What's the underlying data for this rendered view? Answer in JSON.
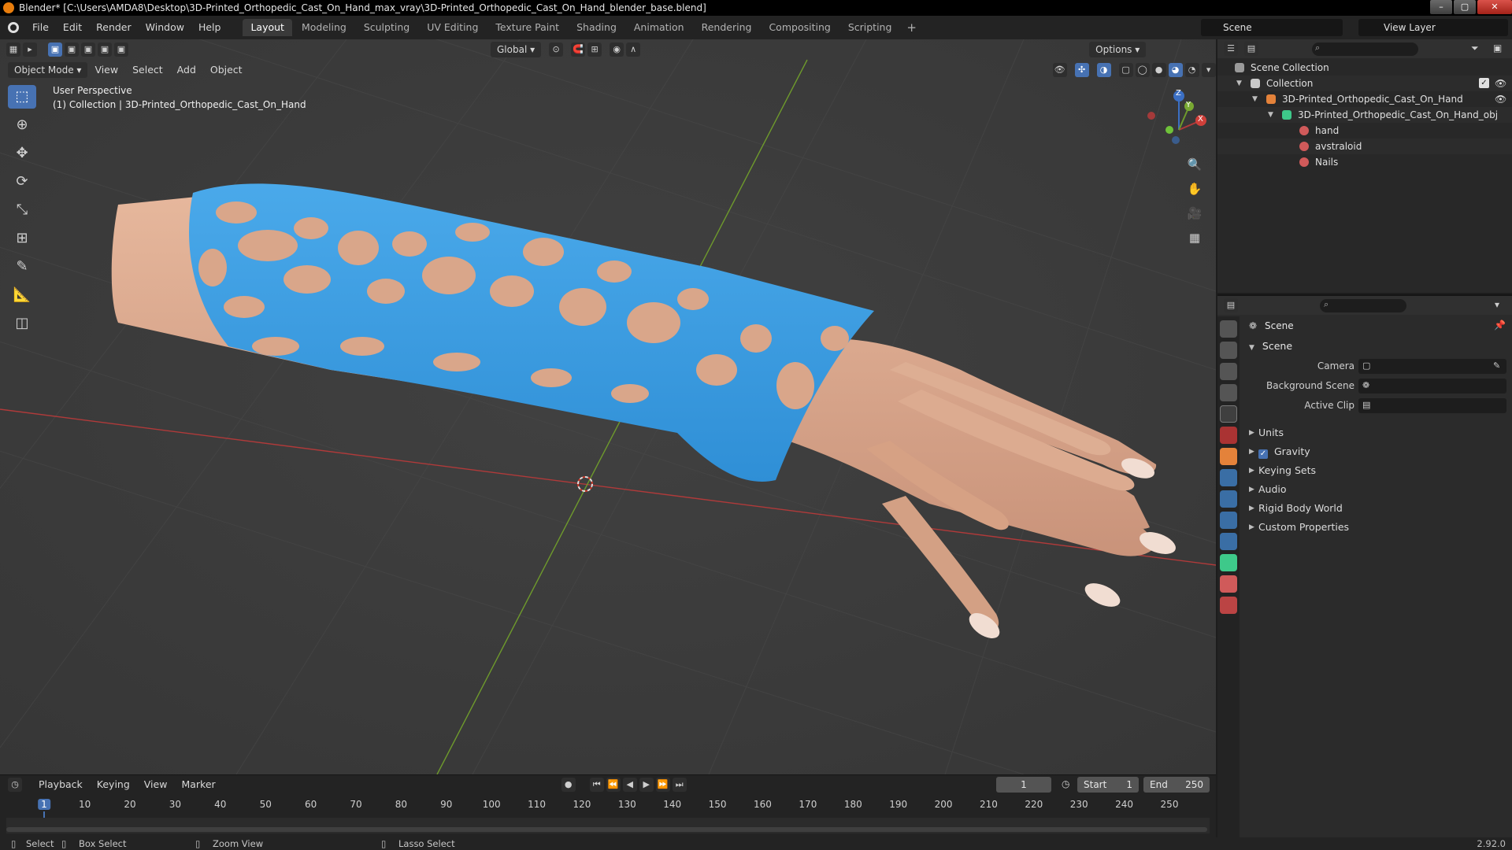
{
  "window": {
    "title": "Blender* [C:\\Users\\AMDA8\\Desktop\\3D-Printed_Orthopedic_Cast_On_Hand_max_vray\\3D-Printed_Orthopedic_Cast_On_Hand_blender_base.blend]",
    "min": "–",
    "max": "▢",
    "close": "✕"
  },
  "menu": [
    "File",
    "Edit",
    "Render",
    "Window",
    "Help"
  ],
  "workspaces": [
    "Layout",
    "Modeling",
    "Sculpting",
    "UV Editing",
    "Texture Paint",
    "Shading",
    "Animation",
    "Rendering",
    "Compositing",
    "Scripting"
  ],
  "workspace_plus": "+",
  "scene_selector": "Scene",
  "view_layer": "View Layer",
  "viewport": {
    "transform_orientation": "Global",
    "options": "Options",
    "mode": "Object Mode",
    "menus": [
      "View",
      "Select",
      "Add",
      "Object"
    ],
    "overlay_line1": "User Perspective",
    "overlay_line2": "(1) Collection | 3D-Printed_Orthopedic_Cast_On_Hand",
    "gizmo": {
      "z": "Z",
      "y": "Y",
      "x": "X"
    }
  },
  "timeline": {
    "menus": [
      "Playback",
      "Keying",
      "View",
      "Marker"
    ],
    "current_frame": "1",
    "start_label": "Start",
    "start": "1",
    "end_label": "End",
    "end": "250",
    "ticks": [
      "1",
      "10",
      "20",
      "30",
      "40",
      "50",
      "60",
      "70",
      "80",
      "90",
      "100",
      "110",
      "120",
      "130",
      "140",
      "150",
      "160",
      "170",
      "180",
      "190",
      "200",
      "210",
      "220",
      "230",
      "240",
      "250"
    ]
  },
  "statusbar": {
    "select": "Select",
    "box_select": "Box Select",
    "zoom_view": "Zoom View",
    "lasso_select": "Lasso Select",
    "version": "2.92.0"
  },
  "outliner": {
    "scene_collection": "Scene Collection",
    "collection": "Collection",
    "object": "3D-Printed_Orthopedic_Cast_On_Hand",
    "mesh": "3D-Printed_Orthopedic_Cast_On_Hand_obj",
    "materials": [
      "hand",
      "avstraloid",
      "Nails"
    ]
  },
  "properties": {
    "context": "Scene",
    "panel": "Scene",
    "fields": {
      "camera": "Camera",
      "background_scene": "Background Scene",
      "active_clip": "Active Clip"
    },
    "subpanels": {
      "units": "Units",
      "gravity": "Gravity",
      "keying_sets": "Keying Sets",
      "audio": "Audio",
      "rigid_body_world": "Rigid Body World",
      "custom_properties": "Custom Properties"
    }
  },
  "colors": {
    "accent": "#4772b3",
    "cast": "#3b9be0",
    "skin": "#d9a68a",
    "x_axis": "#b03a3a",
    "y_axis": "#6e9a2c"
  }
}
